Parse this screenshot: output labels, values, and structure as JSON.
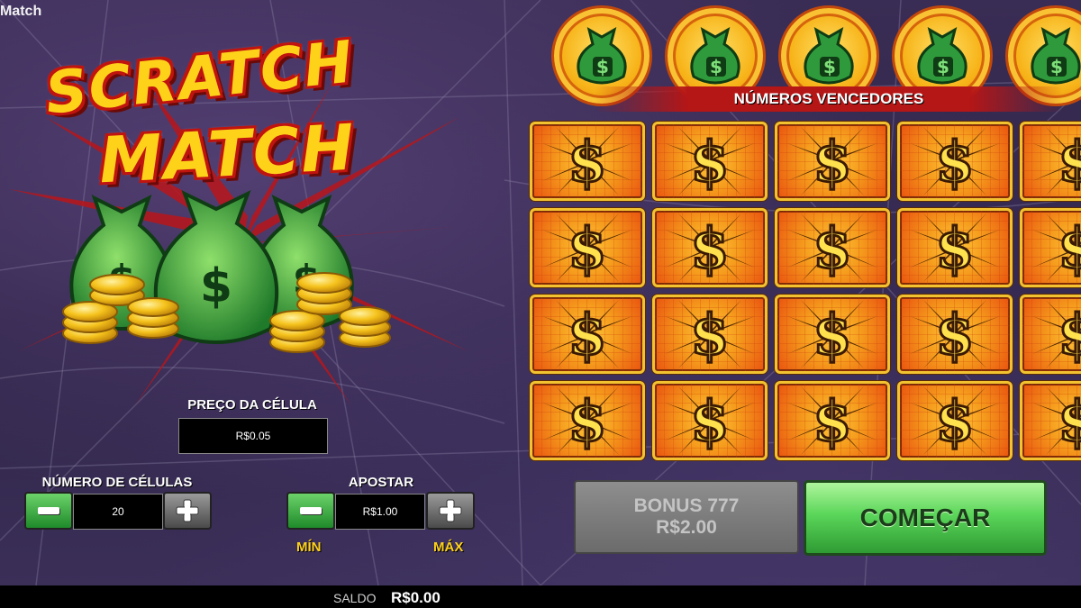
{
  "window": {
    "title": "Match"
  },
  "logo": {
    "line1": "SCRATCH",
    "line2": "MATCH"
  },
  "price": {
    "label": "PREÇO DA CÉLULA",
    "value": "R$0.05"
  },
  "cells_count": {
    "label": "NÚMERO DE CÉLULAS",
    "value": "20"
  },
  "bet": {
    "label": "APOSTAR",
    "value": "R$1.00",
    "min_label": "MÍN",
    "max_label": "MÁX"
  },
  "winning_numbers": {
    "label": "NÚMEROS VENCEDORES",
    "count": 5
  },
  "grid": {
    "rows": 4,
    "cols": 5
  },
  "buttons": {
    "bonus_line1": "BONUS 777",
    "bonus_line2": "R$2.00",
    "start": "COMEÇAR"
  },
  "footer": {
    "balance_label": "SALDO",
    "balance_value": "R$0.00"
  },
  "colors": {
    "accent_gold": "#ffd21a",
    "start_green": "#5bd65a",
    "logo_red": "#c0140f"
  },
  "icons": [
    "money-bag-icon",
    "dollar-sign-icon",
    "minus-icon",
    "plus-icon"
  ]
}
